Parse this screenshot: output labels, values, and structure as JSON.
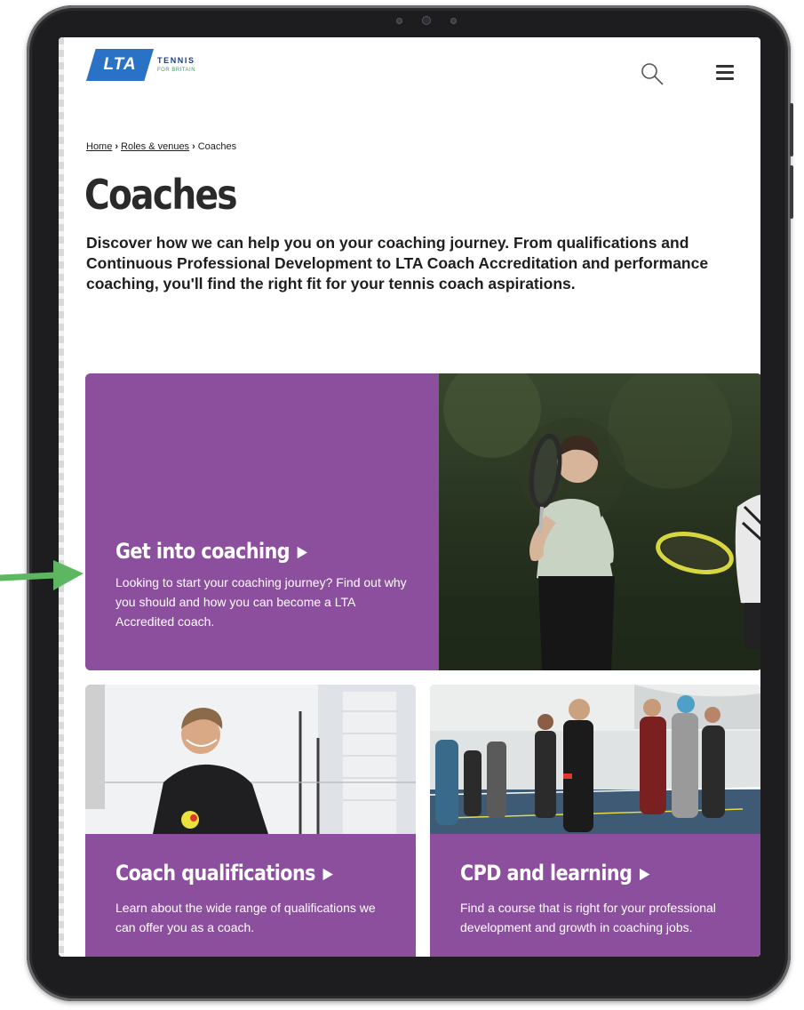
{
  "header": {
    "logo_mark": "LTA",
    "logo_word": "TENNIS",
    "logo_sub": "FOR BRITAIN"
  },
  "breadcrumb": {
    "items": [
      {
        "label": "Home"
      },
      {
        "label": "Roles & venues"
      },
      {
        "label": "Coaches"
      }
    ]
  },
  "page": {
    "title": "Coaches",
    "intro": "Discover how we can help you on your coaching journey. From qualifications and Continuous Professional Development to LTA Coach Accreditation and performance coaching, you'll find the right fit for your tennis coach aspirations."
  },
  "cards": [
    {
      "title": "Get into coaching",
      "description": "Looking to start your coaching journey? Find out why you should and how you can become a LTA Accredited coach.",
      "icon": "triangle-right-icon"
    },
    {
      "title": "Coach qualifications",
      "description": "Learn about the wide range of qualifications we can offer you as a coach.",
      "icon": "triangle-right-icon"
    },
    {
      "title": "CPD and learning",
      "description": "Find a course that is right for your professional development and growth in coaching jobs.",
      "icon": "triangle-right-icon"
    }
  ],
  "colors": {
    "card_purple": "#8c4f9e",
    "logo_blue": "#2a72c6",
    "annotation_arrow": "#5db761",
    "text_dark": "#1e1e1e"
  },
  "icons": [
    "search-icon",
    "hamburger-menu-icon",
    "triangle-right-icon",
    "annotation-arrow-icon"
  ]
}
